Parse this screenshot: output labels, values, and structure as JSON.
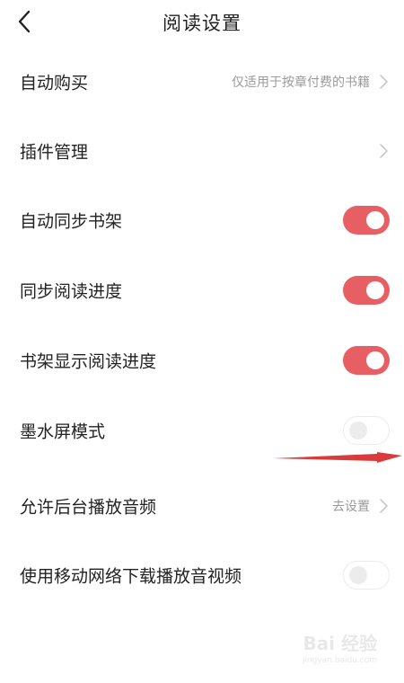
{
  "header": {
    "title": "阅读设置",
    "back_icon": "chevron-left-icon"
  },
  "settings": [
    {
      "label": "自动购买",
      "hint": "仅适用于按章付费的书籍",
      "control": "chevron"
    },
    {
      "label": "插件管理",
      "hint": "",
      "control": "chevron"
    },
    {
      "label": "自动同步书架",
      "control": "toggle",
      "on": true
    },
    {
      "label": "同步阅读进度",
      "control": "toggle",
      "on": true
    },
    {
      "label": "书架显示阅读进度",
      "control": "toggle",
      "on": true
    },
    {
      "label": "墨水屏模式",
      "control": "toggle",
      "on": false
    },
    {
      "label": "允许后台播放音频",
      "hint": "去设置",
      "control": "chevron"
    },
    {
      "label": "使用移动网络下载播放音视频",
      "control": "toggle",
      "on": false
    }
  ],
  "colors": {
    "accent": "#e85f63",
    "text": "#222222",
    "hint": "#9a9a9a",
    "toggle_off_border": "#ececec",
    "annotation_arrow": "#d93a3a"
  },
  "watermark": {
    "text": "Bai 经验",
    "sub": "jingyan.baidu.com"
  }
}
